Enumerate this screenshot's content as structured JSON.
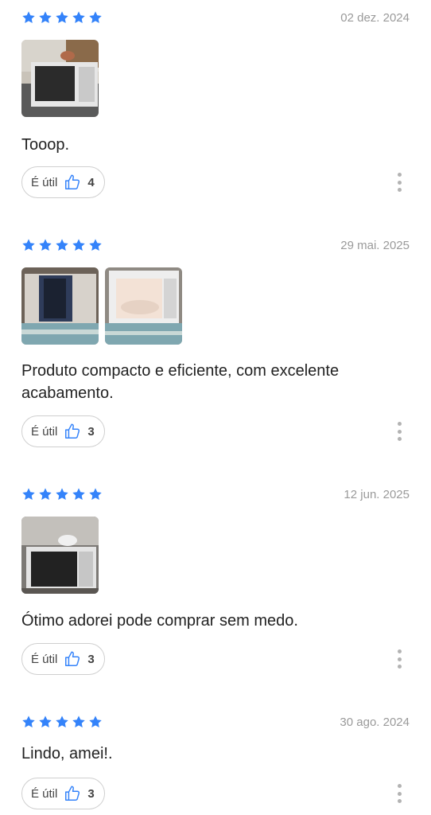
{
  "accent": "#3483fa",
  "useful_label": "É útil",
  "reviews": [
    {
      "rating": 5,
      "date": "02 dez. 2024",
      "photos": [
        "microwave-on-counter"
      ],
      "text": "Tooop.",
      "useful_count": "4"
    },
    {
      "rating": 5,
      "date": "29 mai. 2025",
      "photos": [
        "microwave-on-table",
        "microwave-door-open"
      ],
      "text": "Produto compacto e eficiente, com excelente acabamento.",
      "useful_count": "3"
    },
    {
      "rating": 5,
      "date": "12 jun. 2025",
      "photos": [
        "microwave-in-shelf"
      ],
      "text": "Ótimo adorei pode comprar sem medo.",
      "useful_count": "3"
    },
    {
      "rating": 5,
      "date": "30 ago. 2024",
      "photos": [],
      "text": "Lindo, amei!.",
      "useful_count": "3"
    }
  ]
}
